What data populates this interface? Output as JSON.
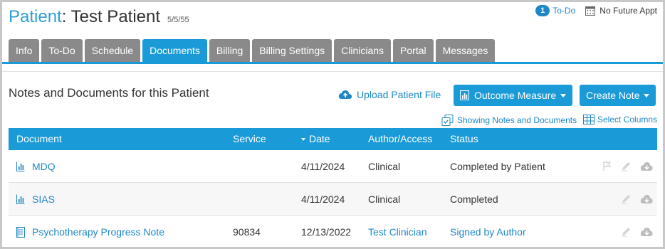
{
  "header": {
    "label": "Patient",
    "name": ": Test Patient",
    "dob": "5/5/55",
    "todo_count": "1",
    "todo_label": "To-Do",
    "appt_label": "No Future Appt"
  },
  "tabs": [
    {
      "label": "Info"
    },
    {
      "label": "To-Do"
    },
    {
      "label": "Schedule"
    },
    {
      "label": "Documents"
    },
    {
      "label": "Billing"
    },
    {
      "label": "Billing Settings"
    },
    {
      "label": "Clinicians"
    },
    {
      "label": "Portal"
    },
    {
      "label": "Messages"
    }
  ],
  "active_tab": "Documents",
  "section": {
    "title": "Notes and Documents for this Patient",
    "upload_label": "Upload Patient File",
    "outcome_label": "Outcome Measure",
    "create_label": "Create Note",
    "showing_label": "Showing Notes and Documents",
    "select_label": "Select Columns"
  },
  "table": {
    "columns": [
      "Document",
      "Service",
      "Date",
      "Author/Access",
      "Status"
    ],
    "rows": [
      {
        "document": "MDQ",
        "service": "",
        "date": "4/11/2024",
        "author": "Clinical",
        "status": "Completed by Patient",
        "icon": "chart-icon"
      },
      {
        "document": "SIAS",
        "service": "",
        "date": "4/11/2024",
        "author": "Clinical",
        "status": "Completed",
        "icon": "chart-icon"
      },
      {
        "document": "Psychotherapy Progress Note",
        "service": "90834",
        "date": "12/13/2022",
        "author": "Test Clinician",
        "status": "Signed by Author",
        "icon": "note-icon"
      }
    ]
  },
  "colors": {
    "accent": "#1a9ad6",
    "link": "#1e88c7",
    "tab_inactive": "#8a8a8a"
  }
}
